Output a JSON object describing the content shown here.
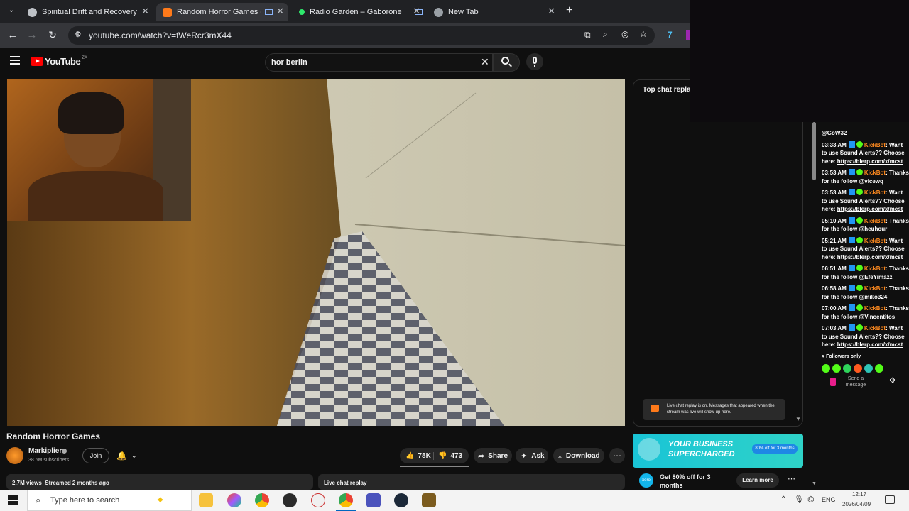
{
  "browser": {
    "tabs": [
      {
        "title": "Spiritual Drift and Recovery",
        "active": false
      },
      {
        "title": "Random Horror Games - Yo",
        "active": true
      },
      {
        "title": "Radio Garden – Gaborone",
        "active": false
      },
      {
        "title": "New Tab",
        "active": false
      }
    ],
    "url": "youtube.com/watch?v=fWeRcr3mX44",
    "new_tab_glyph": "+"
  },
  "youtube": {
    "logo_text": "YouTube",
    "country": "ZA",
    "search_value": "hor berlin",
    "video_title": "Random Horror Games",
    "channel": {
      "name": "Markiplier",
      "subscribers": "38.6M subscribers",
      "join_label": "Join"
    },
    "actions": {
      "likes": "78K",
      "dislikes": "473",
      "share": "Share",
      "ask": "Ask",
      "download": "Download"
    },
    "meta": "2.7M views  Streamed 2 months ago",
    "live_chat_replay_heading": "Live chat replay",
    "chat_header": "Top chat replay",
    "chat_notice": "Live chat replay is on. Messages that appeared when the stream was live will show up here.",
    "ad": {
      "banner_text": "YOUR BUSINESS SUPERCHARGED",
      "banner_badge": "80% off for 3 months",
      "brand": "xero",
      "offer": "Get 80% off for 3 months",
      "learn_more": "Learn more"
    }
  },
  "kick_chat": {
    "top_partial": "@GoW32",
    "messages": [
      {
        "time": "03:33 AM",
        "user": "KickBot",
        "text": "Want to use Sound Alerts?? Choose here:",
        "link": "https://blerp.com/x/mcst"
      },
      {
        "time": "03:53 AM",
        "user": "KickBot",
        "text": "Thanks for the follow @vicewq",
        "link": ""
      },
      {
        "time": "03:53 AM",
        "user": "KickBot",
        "text": "Want to use Sound Alerts?? Choose here:",
        "link": "https://blerp.com/x/mcst"
      },
      {
        "time": "05:10 AM",
        "user": "KickBot",
        "text": "Thanks for the follow @heuhour",
        "link": ""
      },
      {
        "time": "05:21 AM",
        "user": "KickBot",
        "text": "Want to use Sound Alerts?? Choose here:",
        "link": "https://blerp.com/x/mcst"
      },
      {
        "time": "06:51 AM",
        "user": "KickBot",
        "text": "Thanks for the follow @EfeYimazz",
        "link": ""
      },
      {
        "time": "06:58 AM",
        "user": "KickBot",
        "text": "Thanks for the follow @miko324",
        "link": ""
      },
      {
        "time": "07:00 AM",
        "user": "KickBot",
        "text": "Thanks for the follow @Vincentitos",
        "link": ""
      },
      {
        "time": "07:03 AM",
        "user": "KickBot",
        "text": "Want to use Sound Alerts?? Choose here:",
        "link": "https://blerp.com/x/mcst"
      }
    ],
    "followers_only": "Followers only",
    "send_placeholder": "Send a message"
  },
  "taskbar": {
    "search_placeholder": "Type here to search",
    "language": "ENG",
    "time": "12:17",
    "date": "2026/04/09"
  },
  "colors": {
    "youtube_red": "#ff0000",
    "kick_green": "#53fc18",
    "kickbot_orange": "#ff8a1f"
  }
}
